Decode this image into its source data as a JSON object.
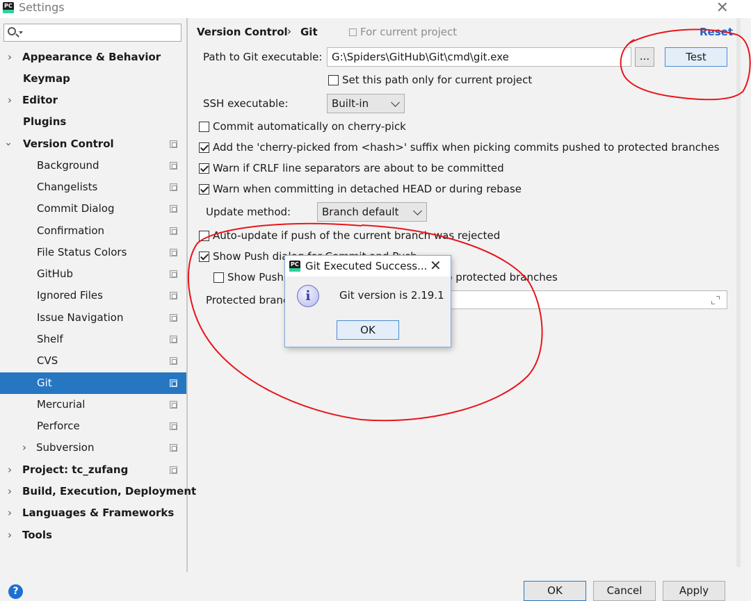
{
  "window": {
    "title": "Settings"
  },
  "sidebar": {
    "search_placeholder": "",
    "items": [
      {
        "label": "Appearance & Behavior"
      },
      {
        "label": "Keymap"
      },
      {
        "label": "Editor"
      },
      {
        "label": "Plugins"
      },
      {
        "label": "Version Control"
      },
      {
        "label": "Background"
      },
      {
        "label": "Changelists"
      },
      {
        "label": "Commit Dialog"
      },
      {
        "label": "Confirmation"
      },
      {
        "label": "File Status Colors"
      },
      {
        "label": "GitHub"
      },
      {
        "label": "Ignored Files"
      },
      {
        "label": "Issue Navigation"
      },
      {
        "label": "Shelf"
      },
      {
        "label": "CVS"
      },
      {
        "label": "Git"
      },
      {
        "label": "Mercurial"
      },
      {
        "label": "Perforce"
      },
      {
        "label": "Subversion"
      },
      {
        "label": "Project: tc_zufang"
      },
      {
        "label": "Build, Execution, Deployment"
      },
      {
        "label": "Languages & Frameworks"
      },
      {
        "label": "Tools"
      }
    ],
    "help_label": "?"
  },
  "header": {
    "breadcrumb_parent": "Version Control",
    "breadcrumb_separator": "›",
    "breadcrumb_current": "Git",
    "scope_text": "For current project",
    "reset_label": "Reset"
  },
  "git": {
    "path_label": "Path to Git executable:",
    "path_value": "G:\\Spiders\\GitHub\\Git\\cmd\\git.exe",
    "browse_label": "...",
    "test_label": "Test",
    "set_path_only_label": "Set this path only for current project",
    "ssh_label": "SSH executable:",
    "ssh_value": "Built-in",
    "commit_auto_label": "Commit automatically on cherry-pick",
    "add_suffix_label": "Add the 'cherry-picked from <hash>' suffix when picking commits pushed to protected branches",
    "warn_crlf_label": "Warn if CRLF line separators are about to be committed",
    "warn_detached_label": "Warn when committing in detached HEAD or during rebase",
    "update_method_label": "Update method:",
    "update_method_value": "Branch default",
    "auto_update_label": "Auto-update if push of the current branch was rejected",
    "show_push_dialog_label": "Show Push dialog for Commit and Push",
    "show_push_protected_label": "Show Push dialog only when committing to protected branches",
    "protected_branches_label": "Protected branches:",
    "protected_branches_value": ""
  },
  "footer": {
    "ok_label": "OK",
    "cancel_label": "Cancel",
    "apply_label": "Apply"
  },
  "dialog": {
    "title": "Git Executed Success...",
    "close_label": "✕",
    "info_glyph": "i",
    "message": "Git version is 2.19.1",
    "ok_label": "OK"
  },
  "colors": {
    "selection": "#2676c2",
    "link": "#2461c5",
    "annotation": "#e8151a",
    "background": "#f2f2f2"
  },
  "icons": {
    "app": "pycharm-icon",
    "search": "search-icon",
    "copy": "project-scope-icon",
    "expand": "expand-icon",
    "info": "info-icon"
  }
}
